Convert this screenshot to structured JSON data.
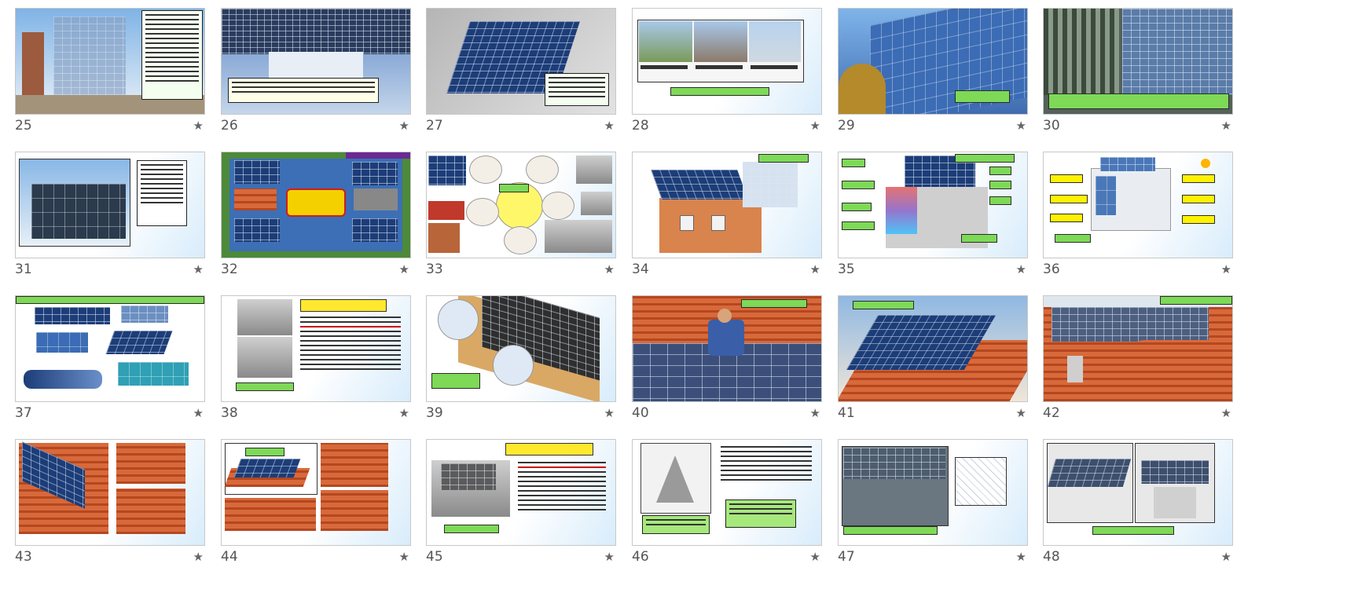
{
  "slides": [
    {
      "number": "25",
      "type": "facade"
    },
    {
      "number": "26",
      "type": "canopy"
    },
    {
      "number": "27",
      "type": "roof-aerial"
    },
    {
      "number": "28",
      "type": "houses"
    },
    {
      "number": "29",
      "type": "glass-building"
    },
    {
      "number": "30",
      "type": "facade-wide"
    },
    {
      "number": "31",
      "type": "office-text"
    },
    {
      "number": "32",
      "type": "bipv-products"
    },
    {
      "number": "33",
      "type": "bipv-technologies"
    },
    {
      "number": "34",
      "type": "house-diagram"
    },
    {
      "number": "35",
      "type": "house-diagram-2"
    },
    {
      "number": "36",
      "type": "building-labels"
    },
    {
      "number": "37",
      "type": "bipv-types"
    },
    {
      "number": "38",
      "type": "text-photos"
    },
    {
      "number": "39",
      "type": "roof-section"
    },
    {
      "number": "40",
      "type": "worker-roof"
    },
    {
      "number": "41",
      "type": "rack-roof"
    },
    {
      "number": "42",
      "type": "tile-roof"
    },
    {
      "number": "43",
      "type": "tile-collage"
    },
    {
      "number": "44",
      "type": "mount-collage"
    },
    {
      "number": "45",
      "type": "text-old-photo"
    },
    {
      "number": "46",
      "type": "sketch-text"
    },
    {
      "number": "47",
      "type": "steel-frame"
    },
    {
      "number": "48",
      "type": "shed-render"
    }
  ],
  "star_icon": "★",
  "colors": {
    "label_green": "#7ed957",
    "label_yellow": "#fff200",
    "panel_blue": "#1c3d78"
  }
}
